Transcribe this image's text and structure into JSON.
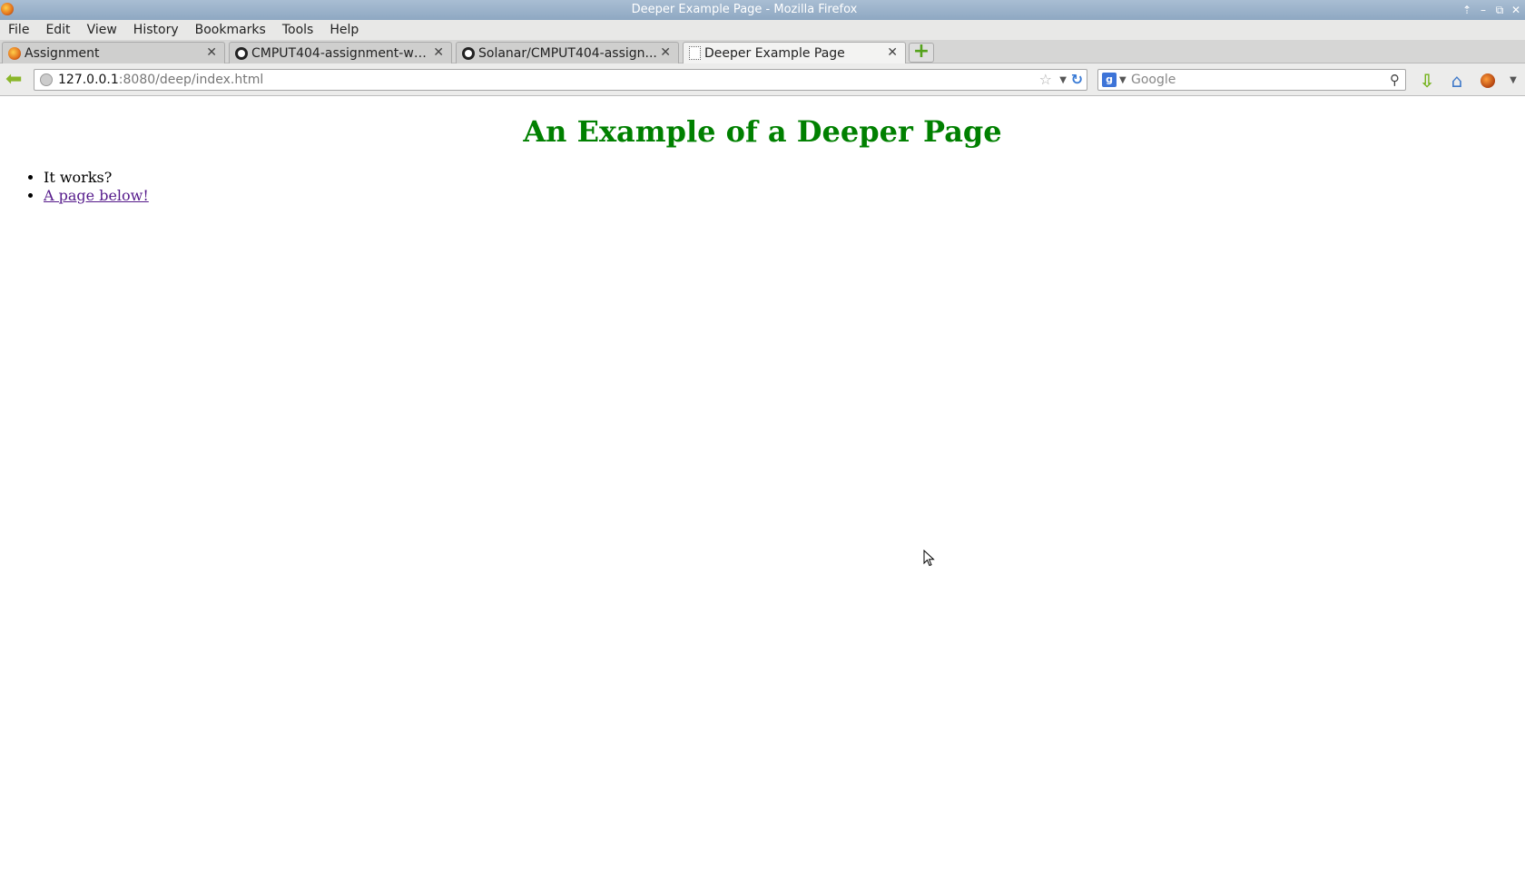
{
  "window": {
    "title": "Deeper Example Page - Mozilla Firefox"
  },
  "menubar": {
    "items": [
      "File",
      "Edit",
      "View",
      "History",
      "Bookmarks",
      "Tools",
      "Help"
    ]
  },
  "tabs": [
    {
      "label": "Assignment",
      "icon": "firefox-icon"
    },
    {
      "label": "CMPUT404-assignment-we...",
      "icon": "github-icon"
    },
    {
      "label": "Solanar/CMPUT404-assign...",
      "icon": "github-icon"
    },
    {
      "label": "Deeper Example Page",
      "icon": "blank-page-icon",
      "active": true
    }
  ],
  "navbar": {
    "url_host": "127.0.0.1",
    "url_rest": ":8080/deep/index.html",
    "search_placeholder": "Google"
  },
  "page": {
    "heading": "An Example of a Deeper Page",
    "heading_color": "#008000",
    "items": [
      {
        "text": "It works?"
      },
      {
        "text": "A page below!",
        "link": true
      }
    ],
    "link_color": "#551a8b"
  }
}
